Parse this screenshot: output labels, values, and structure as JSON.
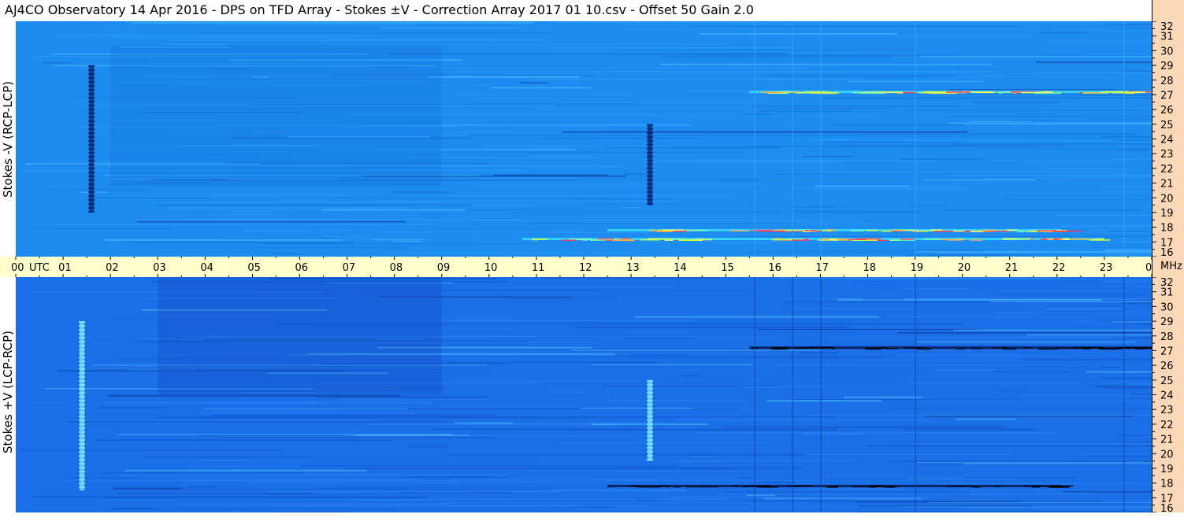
{
  "title": "AJ4CO Observatory  14 Apr 2016  -  DPS on TFD Array  -  Stokes ±V  -  Correction Array 2017 01 10.csv  -  Offset 50  Gain 2.0",
  "panels": {
    "top_label": "Stokes -V (RCP-LCP)",
    "bottom_label": "Stokes +V (LCP-RCP)"
  },
  "time_axis": {
    "first_label": "00 UTC",
    "labels": [
      "01",
      "02",
      "03",
      "04",
      "05",
      "06",
      "07",
      "08",
      "09",
      "10",
      "11",
      "12",
      "13",
      "14",
      "15",
      "16",
      "17",
      "18",
      "19",
      "20",
      "21",
      "22",
      "23",
      "00"
    ]
  },
  "freq_axis": {
    "unit_label": "MHz",
    "labels": [
      "32",
      "31",
      "30",
      "29",
      "28",
      "27",
      "26",
      "25",
      "24",
      "23",
      "22",
      "21",
      "20",
      "19",
      "18",
      "17",
      "16"
    ]
  },
  "colors": {
    "background_top": "#1c8cf0",
    "background_bottom": "#1a6ee6",
    "axis_time_bg": "#ffffcc",
    "axis_freq_bg": "#fad8b8"
  },
  "chart_data": [
    {
      "type": "heatmap",
      "panel": "Stokes -V (RCP-LCP)",
      "x_range_utc_hours": [
        0,
        24
      ],
      "y_range_mhz": [
        16,
        32
      ],
      "features": [
        {
          "kind": "vertical_burst",
          "time_utc": 1.6,
          "freq_mhz": [
            19,
            29
          ],
          "tone": "dark"
        },
        {
          "kind": "vertical_burst",
          "time_utc": 13.4,
          "freq_mhz": [
            19.5,
            25
          ],
          "tone": "dark"
        },
        {
          "kind": "horizontal_band",
          "time_utc": [
            12.5,
            22.1
          ],
          "freq_mhz": 17.8,
          "tone": "bright"
        },
        {
          "kind": "horizontal_band",
          "time_utc": [
            15.5,
            24
          ],
          "freq_mhz": 27.2,
          "tone": "bright"
        },
        {
          "kind": "horizontal_band",
          "time_utc": [
            10.7,
            23
          ],
          "freq_mhz": 17.2,
          "tone": "bright"
        }
      ]
    },
    {
      "type": "heatmap",
      "panel": "Stokes +V (LCP-RCP)",
      "x_range_utc_hours": [
        0,
        24
      ],
      "y_range_mhz": [
        16,
        32
      ],
      "features": [
        {
          "kind": "vertical_burst",
          "time_utc": 1.4,
          "freq_mhz": [
            17.5,
            29
          ],
          "tone": "bright"
        },
        {
          "kind": "vertical_burst",
          "time_utc": 13.4,
          "freq_mhz": [
            19.5,
            25
          ],
          "tone": "bright"
        },
        {
          "kind": "horizontal_band",
          "time_utc": [
            12.5,
            22.1
          ],
          "freq_mhz": 17.8,
          "tone": "dark"
        },
        {
          "kind": "horizontal_band",
          "time_utc": [
            15.5,
            24
          ],
          "freq_mhz": 27.2,
          "tone": "dark"
        }
      ]
    }
  ]
}
